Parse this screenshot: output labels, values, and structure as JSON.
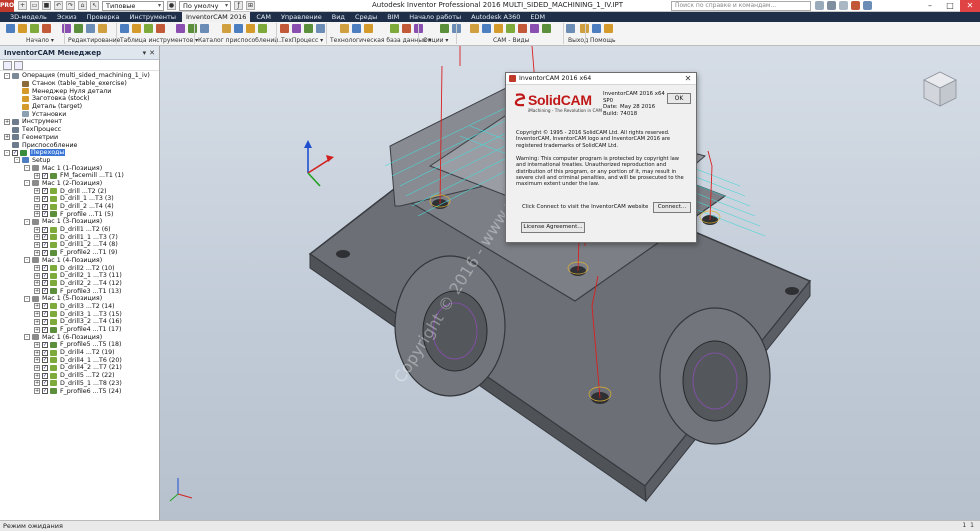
{
  "titlebar": {
    "app_badge": "PRO",
    "style_select": "Типовые",
    "material_select": "По умолчу",
    "title": "Autodesk Inventor Professional 2016   MULTI_SIDED_MACHINING_1_IV.IPT",
    "search_placeholder": "Поиск по справке и командам..."
  },
  "tabs": [
    {
      "label": "3D-модель"
    },
    {
      "label": "Эскиз"
    },
    {
      "label": "Проверка"
    },
    {
      "label": "Инструменты"
    },
    {
      "label": "InventorCAM 2016",
      "active": true
    },
    {
      "label": "CAM"
    },
    {
      "label": "Управление"
    },
    {
      "label": "Вид"
    },
    {
      "label": "Среды"
    },
    {
      "label": "BIM"
    },
    {
      "label": "Начало работы"
    },
    {
      "label": "Autodesk A360"
    },
    {
      "label": "EDM"
    }
  ],
  "ribbon_groups": [
    {
      "label": "Начало ▾"
    },
    {
      "label": "Редактирование"
    },
    {
      "label": "Таблица инструментов ▾"
    },
    {
      "label": "Каталог приспособлений..."
    },
    {
      "label": "ТехПроцесс ▾"
    },
    {
      "label": "Технологическая база данных ▾"
    },
    {
      "label": "Опции ▾"
    },
    {
      "label": "CAM - Виды"
    },
    {
      "label": "Выход"
    },
    {
      "label": "Помощь"
    }
  ],
  "panel": {
    "title": "InventorCAM Менеджер",
    "tree": [
      {
        "label": "Операция (multi_sided_machining_1_iv)",
        "level": 0,
        "exp": "-",
        "icon": "#7a8a99"
      },
      {
        "label": "Станок (table_table_exercise)",
        "level": 1,
        "icon": "#8b6d3a"
      },
      {
        "label": "Менеджер Нуля детали",
        "level": 1,
        "icon": "#d49a2b"
      },
      {
        "label": "Заготовка (stock)",
        "level": 1,
        "icon": "#d49a2b"
      },
      {
        "label": "Деталь (target)",
        "level": 1,
        "icon": "#d49a2b"
      },
      {
        "label": "Установки",
        "level": 1,
        "icon": "#8da0b3"
      },
      {
        "label": "Инструмент",
        "level": 0,
        "exp": "+",
        "icon": "#6d7c8c"
      },
      {
        "label": "ТехПроцесс",
        "level": 0,
        "icon": "#6d7c8c"
      },
      {
        "label": "Геометрии",
        "level": 0,
        "exp": "+",
        "icon": "#6d7c8c"
      },
      {
        "label": "Приспособление",
        "level": 0,
        "icon": "#6d7c8c"
      },
      {
        "label": "Переходы",
        "level": 0,
        "exp": "-",
        "chk": true,
        "icon": "#3a8d3a",
        "selected": true
      },
      {
        "label": "Setup",
        "level": 1,
        "exp": "-",
        "icon": "#4d7fc0"
      },
      {
        "label": "Мас 1 (1-Позиция)",
        "level": 2,
        "exp": "-",
        "icon": "#8b8b8b"
      },
      {
        "label": "FM_facemill ...T1 (1)",
        "level": 3,
        "exp": "+",
        "chk": true,
        "icon": "#5b8f3b"
      },
      {
        "label": "Мас 1 (2-Позиция)",
        "level": 2,
        "exp": "-",
        "icon": "#8b8b8b"
      },
      {
        "label": "D_drill ...T2 (2)",
        "level": 3,
        "exp": "+",
        "chk": true,
        "icon": "#7ea93b"
      },
      {
        "label": "D_drill_1 ...T3 (3)",
        "level": 3,
        "exp": "+",
        "chk": true,
        "icon": "#7ea93b"
      },
      {
        "label": "D_drill_2 ...T4 (4)",
        "level": 3,
        "exp": "+",
        "chk": true,
        "icon": "#7ea93b"
      },
      {
        "label": "F_profile ...T1 (5)",
        "level": 3,
        "exp": "+",
        "chk": true,
        "icon": "#5b8f3b"
      },
      {
        "label": "Мас 1 (3-Позиция)",
        "level": 2,
        "exp": "-",
        "icon": "#8b8b8b"
      },
      {
        "label": "D_drill1 ...T2 (6)",
        "level": 3,
        "exp": "+",
        "chk": true,
        "icon": "#7ea93b"
      },
      {
        "label": "D_drill1_1 ...T3 (7)",
        "level": 3,
        "exp": "+",
        "chk": true,
        "icon": "#7ea93b"
      },
      {
        "label": "D_drill1_2 ...T4 (8)",
        "level": 3,
        "exp": "+",
        "chk": true,
        "icon": "#7ea93b"
      },
      {
        "label": "F_profile2 ...T1 (9)",
        "level": 3,
        "exp": "+",
        "chk": true,
        "icon": "#5b8f3b"
      },
      {
        "label": "Мас 1 (4-Позиция)",
        "level": 2,
        "exp": "-",
        "icon": "#8b8b8b"
      },
      {
        "label": "D_drill2 ...T2 (10)",
        "level": 3,
        "exp": "+",
        "chk": true,
        "icon": "#7ea93b"
      },
      {
        "label": "D_drill2_1 ...T3 (11)",
        "level": 3,
        "exp": "+",
        "chk": true,
        "icon": "#7ea93b"
      },
      {
        "label": "D_drill2_2 ...T4 (12)",
        "level": 3,
        "exp": "+",
        "chk": true,
        "icon": "#7ea93b"
      },
      {
        "label": "F_profile3 ...T1 (13)",
        "level": 3,
        "exp": "+",
        "chk": true,
        "icon": "#5b8f3b"
      },
      {
        "label": "Мас 1 (5-Позиция)",
        "level": 2,
        "exp": "-",
        "icon": "#8b8b8b"
      },
      {
        "label": "D_drill3 ...T2 (14)",
        "level": 3,
        "exp": "+",
        "chk": true,
        "icon": "#7ea93b"
      },
      {
        "label": "D_drill3_1 ...T3 (15)",
        "level": 3,
        "exp": "+",
        "chk": true,
        "icon": "#7ea93b"
      },
      {
        "label": "D_drill3_2 ...T4 (16)",
        "level": 3,
        "exp": "+",
        "chk": true,
        "icon": "#7ea93b"
      },
      {
        "label": "F_profile4 ...T1 (17)",
        "level": 3,
        "exp": "+",
        "chk": true,
        "icon": "#5b8f3b"
      },
      {
        "label": "Мас 1 (6-Позиция)",
        "level": 2,
        "exp": "-",
        "icon": "#8b8b8b"
      },
      {
        "label": "F_profile5 ...T5 (18)",
        "level": 3,
        "exp": "+",
        "chk": true,
        "icon": "#5b8f3b"
      },
      {
        "label": "D_drill4 ...T2 (19)",
        "level": 3,
        "exp": "+",
        "chk": true,
        "icon": "#7ea93b"
      },
      {
        "label": "D_drill4_1 ...T6 (20)",
        "level": 3,
        "exp": "+",
        "chk": true,
        "icon": "#7ea93b"
      },
      {
        "label": "D_drill4_2 ...T7 (21)",
        "level": 3,
        "exp": "+",
        "chk": true,
        "icon": "#7ea93b"
      },
      {
        "label": "D_drill5 ...T2 (22)",
        "level": 3,
        "exp": "+",
        "chk": true,
        "icon": "#7ea93b"
      },
      {
        "label": "D_drill5_1 ...T8 (23)",
        "level": 3,
        "exp": "+",
        "chk": true,
        "icon": "#7ea93b"
      },
      {
        "label": "F_profile6 ...T5 (24)",
        "level": 3,
        "exp": "+",
        "chk": true,
        "icon": "#5b8f3b"
      }
    ]
  },
  "dialog": {
    "title": "InventorCAM 2016 x64",
    "logo_text": "SolidCAM",
    "logo_tagline": "iMachining - The Revolution in CAM",
    "product": "InventorCAM 2016 x64",
    "sp": "SP0",
    "date_label": "Date:",
    "date_value": "May 28 2016",
    "build_label": "Build:",
    "build_value": "74018",
    "ok_label": "OK",
    "copyright": "Copyright © 1995 - 2016 SolidCAM Ltd. All rights reserved. InventorCAM, InventorCAM logo and InventorCAM 2016 are registered trademarks of SolidCAM Ltd.",
    "warning": "Warning: This computer program is protected by copyright law and international treaties. Unauthorized reproduction and distribution of this program, or any portion of it, may result in severe civil and criminal penalties, and will be prosecuted to the maximum extent under the law.",
    "connect_text": "Click Connect to visit the InventorCAM website",
    "connect_button": "Connect...",
    "license_button": "License Agreement..."
  },
  "viewport": {
    "watermark": "Copyright © 2016 - www.p30download.com"
  },
  "status": {
    "text": "Режим ожидания",
    "right_a": "1",
    "right_b": "1"
  },
  "colors": {
    "tab_bar": "#1f2f4a",
    "selection": "#3875d7",
    "logo_red": "#c01818",
    "part_gray": "#6f7278"
  }
}
